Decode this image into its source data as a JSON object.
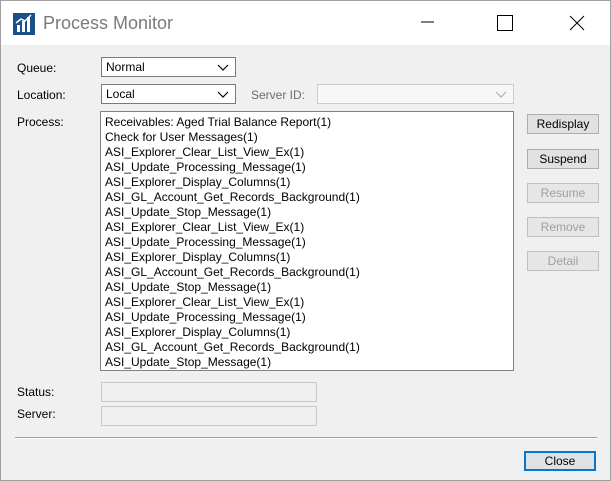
{
  "window": {
    "title": "Process Monitor"
  },
  "queue": {
    "label": "Queue:",
    "value": "Normal"
  },
  "location": {
    "label": "Location:",
    "value": "Local"
  },
  "server_id": {
    "label": "Server ID:",
    "value": ""
  },
  "process": {
    "label": "Process:",
    "items": [
      "Receivables: Aged Trial Balance Report(1)",
      "Check for User Messages(1)",
      "ASI_Explorer_Clear_List_View_Ex(1)",
      "ASI_Update_Processing_Message(1)",
      "ASI_Explorer_Display_Columns(1)",
      "ASI_GL_Account_Get_Records_Background(1)",
      "ASI_Update_Stop_Message(1)",
      "ASI_Explorer_Clear_List_View_Ex(1)",
      "ASI_Update_Processing_Message(1)",
      "ASI_Explorer_Display_Columns(1)",
      "ASI_GL_Account_Get_Records_Background(1)",
      "ASI_Update_Stop_Message(1)",
      "ASI_Explorer_Clear_List_View_Ex(1)",
      "ASI_Update_Processing_Message(1)",
      "ASI_Explorer_Display_Columns(1)",
      "ASI_GL_Account_Get_Records_Background(1)",
      "ASI_Update_Stop_Message(1)"
    ]
  },
  "buttons": {
    "redisplay": "Redisplay",
    "suspend": "Suspend",
    "resume": "Resume",
    "remove": "Remove",
    "detail": "Detail",
    "close": "Close"
  },
  "status": {
    "label": "Status:",
    "value": ""
  },
  "server": {
    "label": "Server:",
    "value": ""
  },
  "colors": {
    "accent": "#0078d7",
    "icon_blue": "#1b4f8a"
  }
}
